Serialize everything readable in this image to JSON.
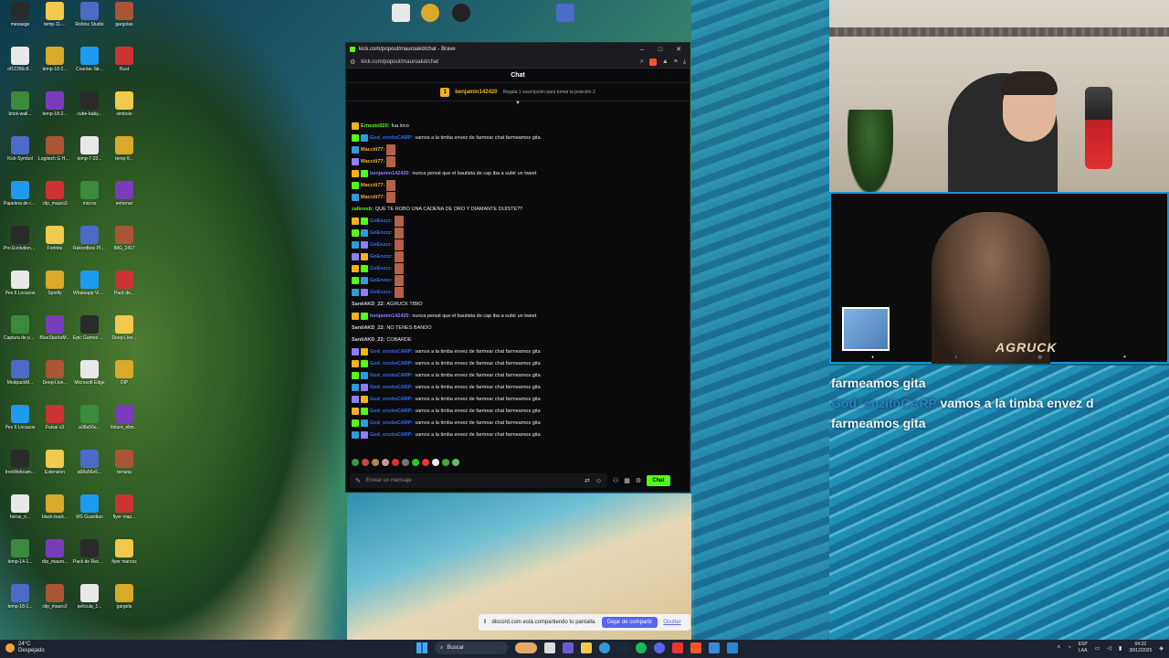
{
  "browser": {
    "window_title": "kick.com/popout/mauroakd/chat - Brave",
    "url": "kick.com/popout/mauroakd/chat"
  },
  "chat": {
    "header": "Chat",
    "pinned": {
      "user": "benjamin142420",
      "note": "Regala 1 suscripción para tomar la posición 2"
    },
    "messages": [
      {
        "user": "Ernesto020",
        "text": "fua loco",
        "color": "#53fc18"
      },
      {
        "user": "God_enzitoCARP",
        "text": "vamos a la timba envez de farmear chat farmeamos gita",
        "color": "#2d6ef5"
      },
      {
        "user": "Macciii77",
        "text": "",
        "color": "#f3b21b",
        "emote": true
      },
      {
        "user": "Macciii77",
        "text": "",
        "color": "#f3b21b",
        "emote": true
      },
      {
        "user": "benjamin142420",
        "text": "nunca pensé que el bautista de cap iba a subir un tweet",
        "color": "#8f7cff"
      },
      {
        "user": "Macciii77",
        "text": "",
        "color": "#f3b21b",
        "emote": true
      },
      {
        "user": "Macciii77",
        "text": "",
        "color": "#f3b21b",
        "emote": true
      },
      {
        "user": "zalkreeb",
        "text": "QUE TE ROBO UNA CADENA DE ORO Y DIAMANTE DIJISTE??",
        "color": "#53fc18"
      },
      {
        "user": "GoEnzzz",
        "text": "",
        "color": "#2d6ef5",
        "emote": true
      },
      {
        "user": "GoEnzzz",
        "text": "",
        "color": "#2d6ef5",
        "emote": true
      },
      {
        "user": "GoEnzzz",
        "text": "",
        "color": "#2d6ef5",
        "emote": true
      },
      {
        "user": "GoEnzzz",
        "text": "",
        "color": "#2d6ef5",
        "emote": true
      },
      {
        "user": "GoEnzzz",
        "text": "",
        "color": "#2d6ef5",
        "emote": true
      },
      {
        "user": "GoEnzzz",
        "text": "",
        "color": "#2d6ef5",
        "emote": true
      },
      {
        "user": "GoEnzzz",
        "text": "",
        "color": "#2d6ef5",
        "emote": true
      },
      {
        "user": "SantiAKD_22",
        "text": "AGRUCK TIBIO",
        "color": "#d0d0d0"
      },
      {
        "user": "benjamin142420",
        "text": "nunca pensé que el bautista de cap iba a subir un tweet",
        "color": "#8f7cff"
      },
      {
        "user": "SantiAKD_22",
        "text": "NO TENES BANDO",
        "color": "#d0d0d0"
      },
      {
        "user": "SantiAKD_22",
        "text": "COBARDE",
        "color": "#d0d0d0"
      },
      {
        "user": "God_enzitoCARP",
        "text": "vamos a la timba envez de farmear chat farmeamos gita",
        "color": "#2d6ef5"
      },
      {
        "user": "God_enzitoCARP",
        "text": "vamos a la timba envez de farmear chat farmeamos gita",
        "color": "#2d6ef5"
      },
      {
        "user": "God_enzitoCARP",
        "text": "vamos a la timba envez de farmear chat farmeamos gita",
        "color": "#2d6ef5"
      },
      {
        "user": "God_enzitoCARP",
        "text": "vamos a la timba envez de farmear chat farmeamos gita",
        "color": "#2d6ef5"
      },
      {
        "user": "God_enzitoCARP",
        "text": "vamos a la timba envez de farmear chat farmeamos gita",
        "color": "#2d6ef5"
      },
      {
        "user": "God_enzitoCARP",
        "text": "vamos a la timba envez de farmear chat farmeamos gita",
        "color": "#2d6ef5"
      },
      {
        "user": "God_enzitoCARP",
        "text": "vamos a la timba envez de farmear chat farmeamos gita",
        "color": "#2d6ef5"
      },
      {
        "user": "God_enzitoCARP",
        "text": "vamos a la timba envez de farmear chat farmeamos gita",
        "color": "#2d6ef5"
      }
    ],
    "input_placeholder": "Enviar un mensaje",
    "send_label": "Chat"
  },
  "overlay": {
    "line1": "farmeamos gita",
    "user": "God_enzitoCARP",
    "line2": "vamos a la timba envez d",
    "line3": "farmeamos gita",
    "cam_logo": "AGRUCK"
  },
  "share": {
    "text": "discord.com está compartiendo tu pantalla.",
    "stop": "Dejar de compartir",
    "hide": "Ocultar"
  },
  "taskbar": {
    "temp": "24°C",
    "weather": "Despejado",
    "search": "Buscar",
    "lang1": "ESP",
    "lang2": "LAA",
    "time": "04:32",
    "date": "30/12/2025"
  },
  "desktop_icons": [
    {
      "label": "mesaage"
    },
    {
      "label": "temp-11-..."
    },
    {
      "label": "Roblox Studio"
    },
    {
      "label": "gargolas"
    },
    {
      "label": "of12356c8..."
    },
    {
      "label": "temp-18-2..."
    },
    {
      "label": "Counter-Str..."
    },
    {
      "label": "Rust"
    },
    {
      "label": "brick-wall..."
    },
    {
      "label": "temp-18-2..."
    },
    {
      "label": "cube-baby..."
    },
    {
      "label": "simbolo"
    },
    {
      "label": "Kick-Symbol"
    },
    {
      "label": "Logitech G HUB"
    },
    {
      "label": "temp-7-23..."
    },
    {
      "label": "temp-9..."
    },
    {
      "label": "Papelera de reciclaje"
    },
    {
      "label": "clip_mauro3"
    },
    {
      "label": "micros"
    },
    {
      "label": "entrenar"
    },
    {
      "label": "Pro Evolution Soccer 6"
    },
    {
      "label": "Fortnite"
    },
    {
      "label": "Rekordbox Player"
    },
    {
      "label": "IMG_2417"
    },
    {
      "label": "Pes 6 Locazos"
    },
    {
      "label": "Spotify"
    },
    {
      "label": "Whatsapp Video 2025"
    },
    {
      "label": "Pack de..."
    },
    {
      "label": "Captura de pantalla"
    },
    {
      "label": "BlueStacksM..."
    },
    {
      "label": "Epic Games Launcher"
    },
    {
      "label": "Deep-Live..."
    },
    {
      "label": "ModpackM..."
    },
    {
      "label": "Deep-Live..."
    },
    {
      "label": "Microsoft Edge"
    },
    {
      "label": "OIP"
    },
    {
      "label": "Pes 6 Locazos"
    },
    {
      "label": "Futsal s3"
    },
    {
      "label": "a98a56e..."
    },
    {
      "label": "fixture_elim..."
    },
    {
      "label": "IronWebcam..."
    },
    {
      "label": "Extension"
    },
    {
      "label": "a98a56e5..."
    },
    {
      "label": "terraria"
    },
    {
      "label": "horse_n..."
    },
    {
      "label": "black-back..."
    },
    {
      "label": "MS Guardian"
    },
    {
      "label": "flyer map..."
    },
    {
      "label": "temp-14-1..."
    },
    {
      "label": "clip_mauro..."
    },
    {
      "label": "Pack de Recursos"
    },
    {
      "label": "flyer marcos"
    },
    {
      "label": "temp-18-1..."
    },
    {
      "label": "clip_mauro2"
    },
    {
      "label": "pelicula_1..."
    },
    {
      "label": "gargola"
    }
  ]
}
